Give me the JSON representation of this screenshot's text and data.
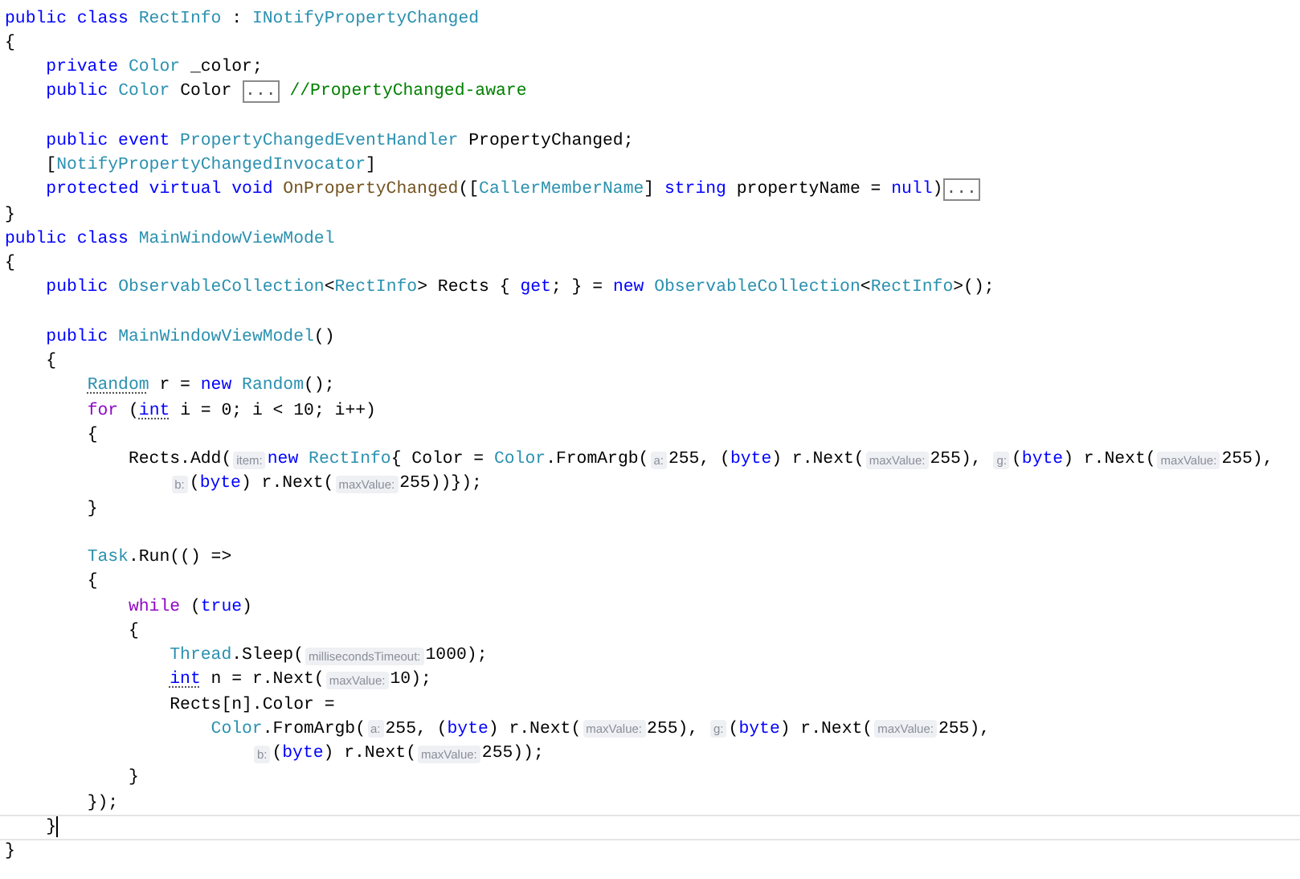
{
  "editor": {
    "lines": [
      {
        "tokens": [
          {
            "kind": "kw",
            "text": "public class "
          },
          {
            "kind": "type",
            "text": "RectInfo"
          },
          {
            "kind": "plain",
            "text": " : "
          },
          {
            "kind": "type",
            "text": "INotifyPropertyChanged"
          }
        ]
      },
      {
        "tokens": [
          {
            "kind": "plain",
            "text": "{"
          }
        ]
      },
      {
        "tokens": [
          {
            "kind": "kw",
            "text": "    private "
          },
          {
            "kind": "type",
            "text": "Color"
          },
          {
            "kind": "plain",
            "text": " _color;"
          }
        ]
      },
      {
        "blank_line_after": true,
        "tokens": [
          {
            "kind": "kw",
            "text": "    public "
          },
          {
            "kind": "type",
            "text": "Color"
          },
          {
            "kind": "plain",
            "text": " Color "
          },
          {
            "kind": "fold",
            "text": "..."
          },
          {
            "kind": "comment",
            "text": " //PropertyChanged-aware"
          }
        ]
      },
      {
        "tokens": [
          {
            "kind": "kw",
            "text": "    public event "
          },
          {
            "kind": "type",
            "text": "PropertyChangedEventHandler"
          },
          {
            "kind": "plain",
            "text": " PropertyChanged;"
          }
        ]
      },
      {
        "tokens": [
          {
            "kind": "plain",
            "text": "    ["
          },
          {
            "kind": "type",
            "text": "NotifyPropertyChangedInvocator"
          },
          {
            "kind": "plain",
            "text": "]"
          }
        ]
      },
      {
        "tokens": [
          {
            "kind": "kw",
            "text": "    protected virtual void "
          },
          {
            "kind": "method",
            "text": "OnPropertyChanged"
          },
          {
            "kind": "plain",
            "text": "(["
          },
          {
            "kind": "type",
            "text": "CallerMemberName"
          },
          {
            "kind": "plain",
            "text": "] "
          },
          {
            "kind": "kw",
            "text": "string"
          },
          {
            "kind": "plain",
            "text": " propertyName = "
          },
          {
            "kind": "kw",
            "text": "null"
          },
          {
            "kind": "plain",
            "text": ")"
          },
          {
            "kind": "fold",
            "text": "..."
          }
        ]
      },
      {
        "tokens": [
          {
            "kind": "plain",
            "text": "}"
          }
        ]
      },
      {
        "tokens": [
          {
            "kind": "kw",
            "text": "public class "
          },
          {
            "kind": "type",
            "text": "MainWindowViewModel"
          }
        ]
      },
      {
        "tokens": [
          {
            "kind": "plain",
            "text": "{"
          }
        ]
      },
      {
        "blank_line_after": true,
        "tokens": [
          {
            "kind": "kw",
            "text": "    public "
          },
          {
            "kind": "type",
            "text": "ObservableCollection"
          },
          {
            "kind": "plain",
            "text": "<"
          },
          {
            "kind": "type",
            "text": "RectInfo"
          },
          {
            "kind": "plain",
            "text": "> Rects { "
          },
          {
            "kind": "kw",
            "text": "get"
          },
          {
            "kind": "plain",
            "text": "; } = "
          },
          {
            "kind": "kw",
            "text": "new "
          },
          {
            "kind": "type",
            "text": "ObservableCollection"
          },
          {
            "kind": "plain",
            "text": "<"
          },
          {
            "kind": "type",
            "text": "RectInfo"
          },
          {
            "kind": "plain",
            "text": ">();"
          }
        ]
      },
      {
        "tokens": [
          {
            "kind": "kw",
            "text": "    public "
          },
          {
            "kind": "type",
            "text": "MainWindowViewModel"
          },
          {
            "kind": "plain",
            "text": "()"
          }
        ]
      },
      {
        "tokens": [
          {
            "kind": "plain",
            "text": "    {"
          }
        ]
      },
      {
        "tokens": [
          {
            "kind": "type",
            "text": "        Random",
            "dotted": true
          },
          {
            "kind": "plain",
            "text": " r = "
          },
          {
            "kind": "kw",
            "text": "new "
          },
          {
            "kind": "type",
            "text": "Random"
          },
          {
            "kind": "plain",
            "text": "();"
          }
        ]
      },
      {
        "tokens": [
          {
            "kind": "ctl",
            "text": "        for"
          },
          {
            "kind": "plain",
            "text": " ("
          },
          {
            "kind": "kw",
            "text": "int",
            "dotted": true
          },
          {
            "kind": "plain",
            "text": " i = 0; i < 10; i++)"
          }
        ]
      },
      {
        "tokens": [
          {
            "kind": "plain",
            "text": "        {"
          }
        ]
      },
      {
        "tokens": [
          {
            "kind": "plain",
            "text": "            Rects.Add("
          },
          {
            "kind": "hint",
            "text": "item:"
          },
          {
            "kind": "kw",
            "text": "new "
          },
          {
            "kind": "type",
            "text": "RectInfo"
          },
          {
            "kind": "plain",
            "text": "{ Color = "
          },
          {
            "kind": "type",
            "text": "Color"
          },
          {
            "kind": "plain",
            "text": ".FromArgb("
          },
          {
            "kind": "hint",
            "text": "a:"
          },
          {
            "kind": "plain",
            "text": "255, ("
          },
          {
            "kind": "kw",
            "text": "byte"
          },
          {
            "kind": "plain",
            "text": ") r.Next("
          },
          {
            "kind": "hint",
            "text": "maxValue:"
          },
          {
            "kind": "plain",
            "text": "255), "
          },
          {
            "kind": "hint",
            "text": "g:"
          },
          {
            "kind": "plain",
            "text": "("
          },
          {
            "kind": "kw",
            "text": "byte"
          },
          {
            "kind": "plain",
            "text": ") r.Next("
          },
          {
            "kind": "hint",
            "text": "maxValue:"
          },
          {
            "kind": "plain",
            "text": "255),"
          }
        ]
      },
      {
        "tokens": [
          {
            "kind": "hint",
            "text": "                b:"
          },
          {
            "kind": "plain",
            "text": "("
          },
          {
            "kind": "kw",
            "text": "byte"
          },
          {
            "kind": "plain",
            "text": ") r.Next("
          },
          {
            "kind": "hint",
            "text": "maxValue:"
          },
          {
            "kind": "plain",
            "text": "255))});"
          }
        ]
      },
      {
        "blank_line_after": true,
        "tokens": [
          {
            "kind": "plain",
            "text": "        }"
          }
        ]
      },
      {
        "tokens": [
          {
            "kind": "type",
            "text": "        Task"
          },
          {
            "kind": "plain",
            "text": ".Run(() =>"
          }
        ]
      },
      {
        "tokens": [
          {
            "kind": "plain",
            "text": "        {"
          }
        ]
      },
      {
        "tokens": [
          {
            "kind": "ctl",
            "text": "            while"
          },
          {
            "kind": "plain",
            "text": " ("
          },
          {
            "kind": "kw",
            "text": "true"
          },
          {
            "kind": "plain",
            "text": ")"
          }
        ]
      },
      {
        "tokens": [
          {
            "kind": "plain",
            "text": "            {"
          }
        ]
      },
      {
        "tokens": [
          {
            "kind": "type",
            "text": "                Thread"
          },
          {
            "kind": "plain",
            "text": ".Sleep("
          },
          {
            "kind": "hint",
            "text": "millisecondsTimeout:"
          },
          {
            "kind": "plain",
            "text": "1000);"
          }
        ]
      },
      {
        "tokens": [
          {
            "kind": "kw",
            "text": "                int",
            "dotted": true
          },
          {
            "kind": "plain",
            "text": " n = r.Next("
          },
          {
            "kind": "hint",
            "text": "maxValue:"
          },
          {
            "kind": "plain",
            "text": "10);"
          }
        ]
      },
      {
        "tokens": [
          {
            "kind": "plain",
            "text": "                Rects[n].Color ="
          }
        ]
      },
      {
        "tokens": [
          {
            "kind": "type",
            "text": "                    Color"
          },
          {
            "kind": "plain",
            "text": ".FromArgb("
          },
          {
            "kind": "hint",
            "text": "a:"
          },
          {
            "kind": "plain",
            "text": "255, ("
          },
          {
            "kind": "kw",
            "text": "byte"
          },
          {
            "kind": "plain",
            "text": ") r.Next("
          },
          {
            "kind": "hint",
            "text": "maxValue:"
          },
          {
            "kind": "plain",
            "text": "255), "
          },
          {
            "kind": "hint",
            "text": "g:"
          },
          {
            "kind": "plain",
            "text": "("
          },
          {
            "kind": "kw",
            "text": "byte"
          },
          {
            "kind": "plain",
            "text": ") r.Next("
          },
          {
            "kind": "hint",
            "text": "maxValue:"
          },
          {
            "kind": "plain",
            "text": "255),"
          }
        ]
      },
      {
        "tokens": [
          {
            "kind": "hint",
            "text": "                        b:"
          },
          {
            "kind": "plain",
            "text": "("
          },
          {
            "kind": "kw",
            "text": "byte"
          },
          {
            "kind": "plain",
            "text": ") r.Next("
          },
          {
            "kind": "hint",
            "text": "maxValue:"
          },
          {
            "kind": "plain",
            "text": "255));"
          }
        ]
      },
      {
        "tokens": [
          {
            "kind": "plain",
            "text": "            }"
          }
        ]
      },
      {
        "tokens": [
          {
            "kind": "plain",
            "text": "        });"
          }
        ]
      },
      {
        "current": true,
        "tokens": [
          {
            "kind": "plain",
            "text": "    }"
          }
        ]
      },
      {
        "tokens": [
          {
            "kind": "plain",
            "text": "}"
          }
        ]
      }
    ]
  }
}
